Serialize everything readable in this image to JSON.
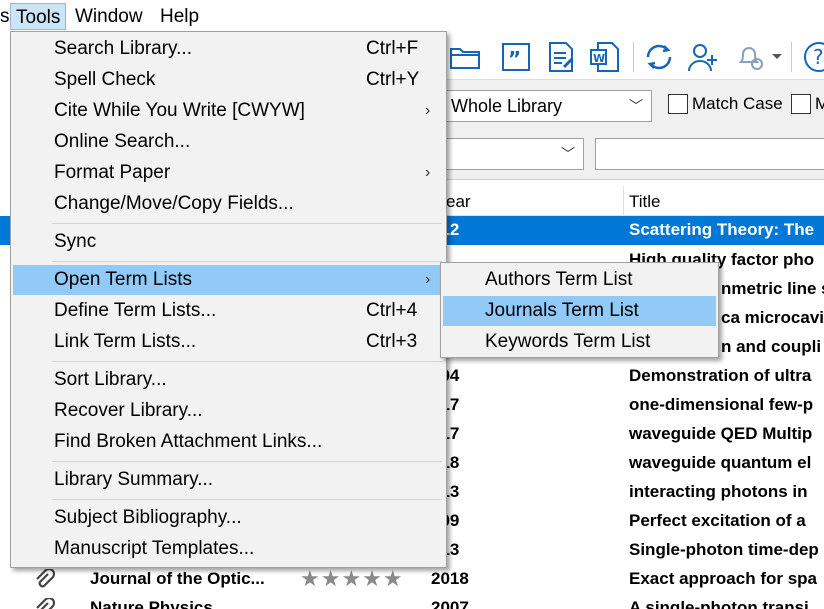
{
  "menubar": {
    "items": [
      {
        "label": "s"
      },
      {
        "label": "Tools"
      },
      {
        "label": "Window"
      },
      {
        "label": "Help"
      }
    ]
  },
  "tools_menu": {
    "items": [
      {
        "label": "Search Library...",
        "shortcut": "Ctrl+F"
      },
      {
        "label": "Spell Check",
        "shortcut": "Ctrl+Y"
      },
      {
        "label": "Cite While You Write [CWYW]",
        "shortcut": ""
      },
      {
        "label": "Online Search...",
        "shortcut": ""
      },
      {
        "label": "Format Paper",
        "shortcut": ""
      },
      {
        "label": "Change/Move/Copy Fields...",
        "shortcut": ""
      },
      {
        "label": "Sync",
        "shortcut": ""
      },
      {
        "label": "Open Term Lists",
        "shortcut": ""
      },
      {
        "label": "Define Term Lists...",
        "shortcut": "Ctrl+4"
      },
      {
        "label": "Link Term Lists...",
        "shortcut": "Ctrl+3"
      },
      {
        "label": "Sort Library...",
        "shortcut": ""
      },
      {
        "label": "Recover Library...",
        "shortcut": ""
      },
      {
        "label": "Find Broken Attachment Links...",
        "shortcut": ""
      },
      {
        "label": "Library Summary...",
        "shortcut": ""
      },
      {
        "label": "Subject Bibliography...",
        "shortcut": ""
      },
      {
        "label": "Manuscript Templates...",
        "shortcut": ""
      }
    ],
    "submenu_arrow": "›"
  },
  "term_lists_submenu": {
    "items": [
      {
        "label": "Authors Term List"
      },
      {
        "label": "Journals Term List"
      },
      {
        "label": "Keywords Term List"
      }
    ]
  },
  "search": {
    "scope_value": "Whole Library",
    "match_case_label": "Match Case",
    "match_words_label": "M"
  },
  "table": {
    "headers": {
      "year": "ear",
      "title": "Title"
    },
    "rows": [
      {
        "journal": "",
        "year": "012",
        "title": "Scattering Theory: The"
      },
      {
        "journal": "",
        "year": "",
        "title": "High quality factor pho"
      },
      {
        "journal": "",
        "year": "",
        "title": "nmetric line s"
      },
      {
        "journal": "",
        "year": "",
        "title": "ca microcavi"
      },
      {
        "journal": "",
        "year": "",
        "title": "n and coupli"
      },
      {
        "journal": "",
        "year": "004",
        "title": "Demonstration of ultra"
      },
      {
        "journal": "",
        "year": "017",
        "title": "one-dimensional few-p"
      },
      {
        "journal": "",
        "year": "017",
        "title": "waveguide QED Multip"
      },
      {
        "journal": "",
        "year": "018",
        "title": "waveguide quantum el"
      },
      {
        "journal": "",
        "year": "013",
        "title": "interacting photons in"
      },
      {
        "journal": "",
        "year": "009",
        "title": "Perfect excitation of a"
      },
      {
        "journal": "",
        "year": "013",
        "title": "Single-photon time-dep"
      },
      {
        "journal": "Journal of the Optic...",
        "year": "2018",
        "title": "Exact approach for spa"
      },
      {
        "journal": "Nature Physics",
        "year": "2007",
        "title": "A single-photon transi"
      }
    ],
    "rating_stars": "★★★★★"
  },
  "colors": {
    "selection": "#0078d7",
    "menu_highlight": "#91c9f7",
    "menu_bg": "#f2f2f2",
    "icon_blue": "#1565b8"
  }
}
